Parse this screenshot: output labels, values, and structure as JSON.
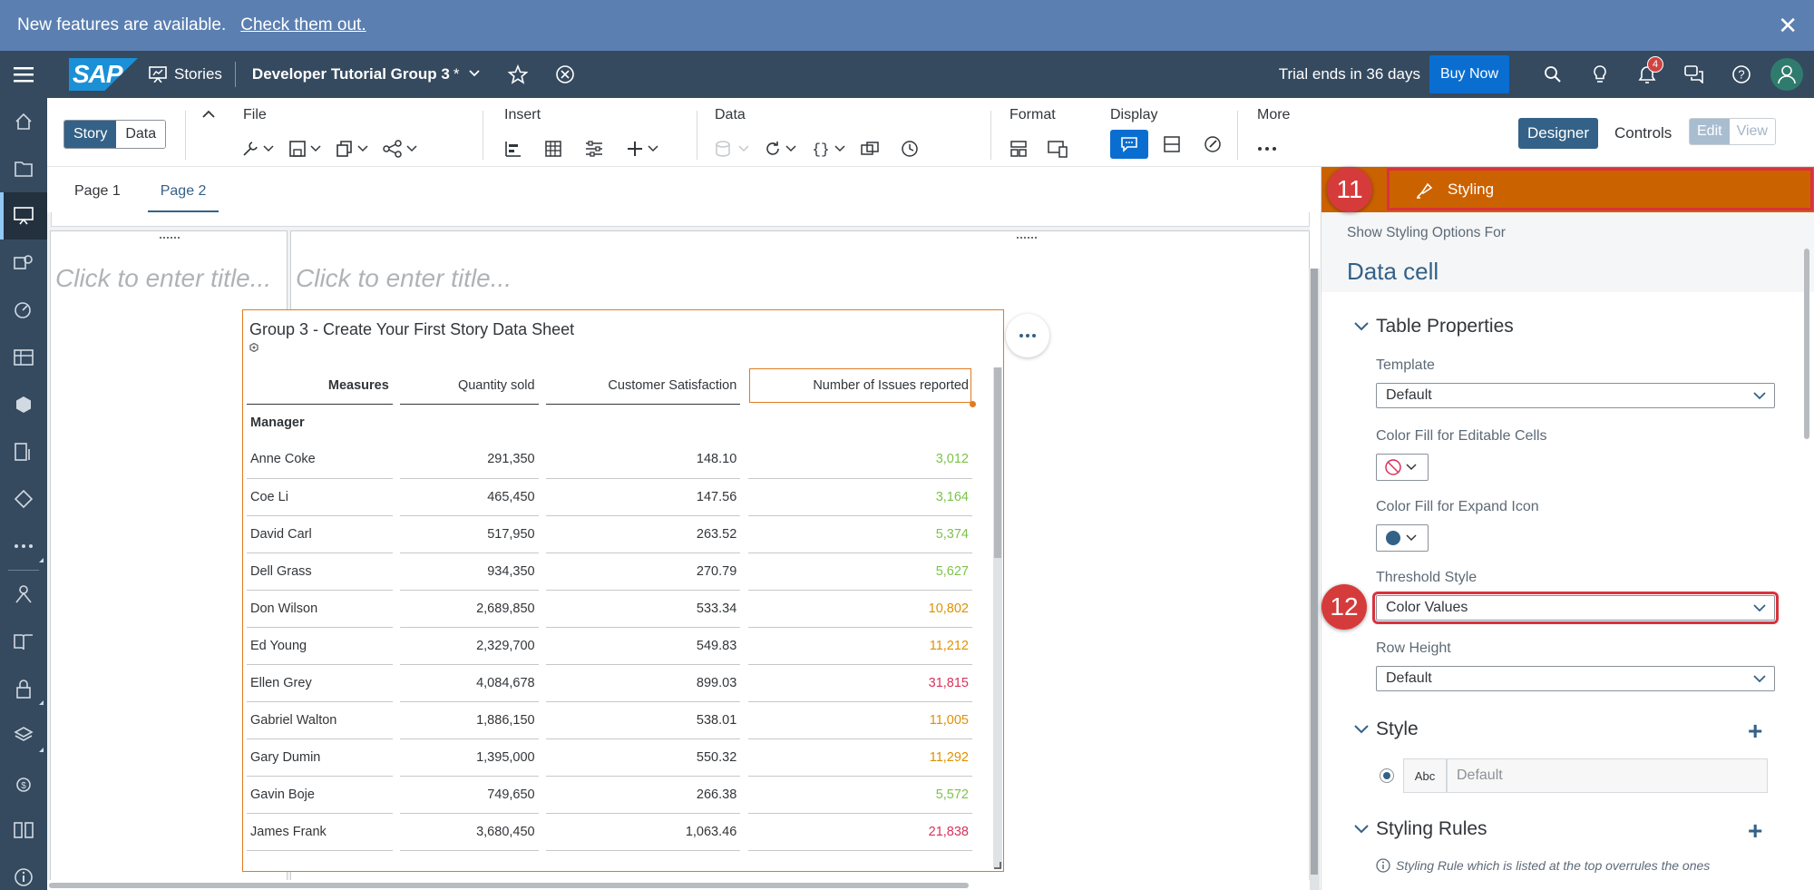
{
  "banner": {
    "text": "New features are available.",
    "link": "Check them out."
  },
  "shell": {
    "app": "Stories",
    "doc_title": "Developer Tutorial Group 3",
    "dirty_mark": "*",
    "trial": "Trial ends in 36 days",
    "buy": "Buy Now",
    "notifications": "4"
  },
  "toolbar": {
    "story": "Story",
    "data": "Data",
    "groups": {
      "file": "File",
      "insert": "Insert",
      "data": "Data",
      "format": "Format",
      "display": "Display",
      "more": "More"
    },
    "designer": "Designer",
    "controls": "Controls",
    "edit": "Edit",
    "view": "View"
  },
  "tabs": [
    "Page 1",
    "Page 2"
  ],
  "canvas": {
    "placeholder_left": "Click to enter title...",
    "placeholder_right": "Click to enter title..."
  },
  "table": {
    "title": "Group 3 - Create Your First Story Data Sheet",
    "headers": [
      "Measures",
      "Quantity sold",
      "Customer Satisfaction",
      "Number of Issues reported"
    ],
    "dimension": "Manager",
    "rows": [
      {
        "name": "Anne Coke",
        "qty": "291,350",
        "sat": "148.10",
        "issues": "3,012",
        "color": "#7cc34a"
      },
      {
        "name": "Coe Li",
        "qty": "465,450",
        "sat": "147.56",
        "issues": "3,164",
        "color": "#7cc34a"
      },
      {
        "name": "David Carl",
        "qty": "517,950",
        "sat": "263.52",
        "issues": "5,374",
        "color": "#7cc34a"
      },
      {
        "name": "Dell Grass",
        "qty": "934,350",
        "sat": "270.79",
        "issues": "5,627",
        "color": "#7cc34a"
      },
      {
        "name": "Don Wilson",
        "qty": "2,689,850",
        "sat": "533.34",
        "issues": "10,802",
        "color": "#e09000"
      },
      {
        "name": "Ed Young",
        "qty": "2,329,700",
        "sat": "549.83",
        "issues": "11,212",
        "color": "#e09000"
      },
      {
        "name": "Ellen Grey",
        "qty": "4,084,678",
        "sat": "899.03",
        "issues": "31,815",
        "color": "#d9325b"
      },
      {
        "name": "Gabriel Walton",
        "qty": "1,886,150",
        "sat": "538.01",
        "issues": "11,005",
        "color": "#e09000"
      },
      {
        "name": "Gary Dumin",
        "qty": "1,395,000",
        "sat": "550.32",
        "issues": "11,292",
        "color": "#e09000"
      },
      {
        "name": "Gavin Boje",
        "qty": "749,650",
        "sat": "266.38",
        "issues": "5,572",
        "color": "#7cc34a"
      },
      {
        "name": "James Frank",
        "qty": "3,680,450",
        "sat": "1,063.46",
        "issues": "21,838",
        "color": "#d9325b"
      }
    ]
  },
  "panel": {
    "step11": "11",
    "step12": "12",
    "header": "Styling",
    "show_for": "Show Styling Options For",
    "target": "Data cell",
    "table_properties": "Table Properties",
    "template_label": "Template",
    "template_value": "Default",
    "fill_editable_label": "Color Fill for Editable Cells",
    "fill_expand_label": "Color Fill for Expand Icon",
    "threshold_label": "Threshold Style",
    "threshold_value": "Color Values",
    "row_height_label": "Row Height",
    "row_height_value": "Default",
    "style": "Style",
    "abc": "Abc",
    "style_value": "Default",
    "styling_rules": "Styling Rules",
    "rules_note": "Styling Rule which is listed at the top overrules the ones"
  },
  "colors": {
    "shell": "#354a5f",
    "banner": "#5b7fb0",
    "accent": "#cb6200",
    "highlight": "#d9323d"
  }
}
